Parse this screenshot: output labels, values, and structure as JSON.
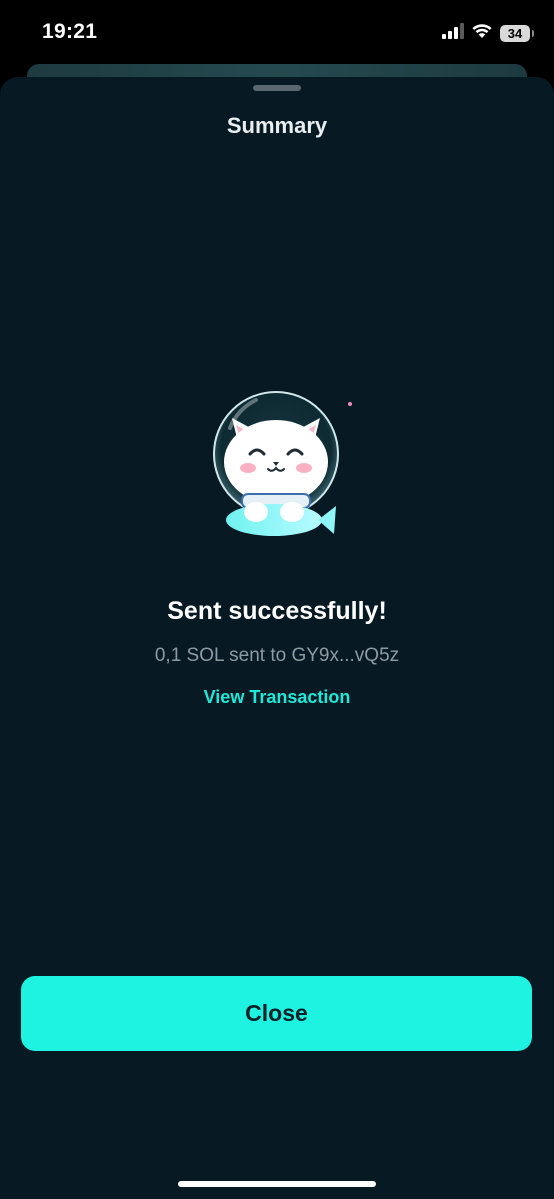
{
  "status_bar": {
    "time": "19:21",
    "battery": "34",
    "icons": [
      "signal-icon",
      "wifi-icon",
      "battery-icon"
    ]
  },
  "sheet": {
    "title": "Summary"
  },
  "result": {
    "headline": "Sent successfully!",
    "details": "0,1 SOL sent to GY9x...vQ5z",
    "link_label": "View Transaction"
  },
  "actions": {
    "close_label": "Close"
  },
  "colors": {
    "background": "#071923",
    "accent": "#1ef2e0",
    "link": "#1de9d8",
    "muted_text": "#8e9aa2"
  }
}
